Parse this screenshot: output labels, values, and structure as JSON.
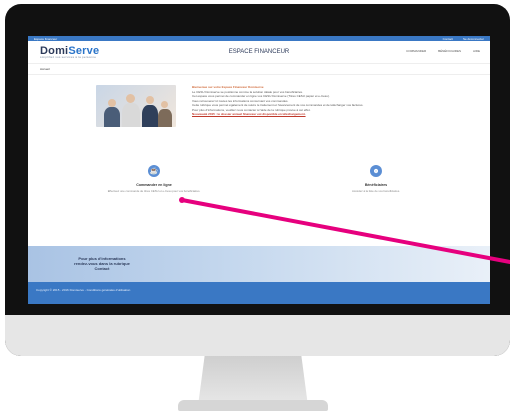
{
  "topbar": {
    "left": "Espace financeur",
    "right_1": "Contact",
    "right_2": "Se déconnecter"
  },
  "header": {
    "logo_main": "Domi",
    "logo_accent": "Serve",
    "logo_tag": "simplifiez vos services à la personne",
    "title": "ESPACE FINANCEUR",
    "nav": [
      "COMMANDER",
      "BÉNÉFICIAIRES",
      "AIDE"
    ]
  },
  "breadcrumb": "Accueil",
  "intro": {
    "heading": "Bienvenue sur votre Espace Financeur Domiserve",
    "lines": [
      "Le CESU Domiserve se positionne comme la solution idéale pour vos bénéficiaires.",
      "Cet espace vous permet de commander en ligne vos CESU Domiserve (Titres CESU papier et e-Cesu).",
      "Vous retrouverez ici toutes les informations concernant vos commandes.",
      "Cette rubrique vous permet également de suivre le traitement et l'avancement de vos commandes et de télécharger vos factures.",
      "Pour plus d'informations, veuillez nous contacter à l'aide de la rubrique prévue à cet effet."
    ],
    "warning": "Nouveauté 2015 : le dossier annuel financeur est disponible en téléchargement."
  },
  "cards": [
    {
      "icon": "cart-icon",
      "title": "Commander en ligne",
      "desc": "Effectuez une commande de titres CESU et e-Cesu pour vos bénéficiaires."
    },
    {
      "icon": "users-icon",
      "title": "Bénéficiaires",
      "desc": "Accédez à la liste de vos bénéficiaires."
    }
  ],
  "banner": {
    "message": "Pour plus d'informations rendez-vous dans la rubrique Contact"
  },
  "footer": {
    "text": "Copyright © 2015 - 2016 Domiserve - Conditions générales d'utilisation"
  }
}
